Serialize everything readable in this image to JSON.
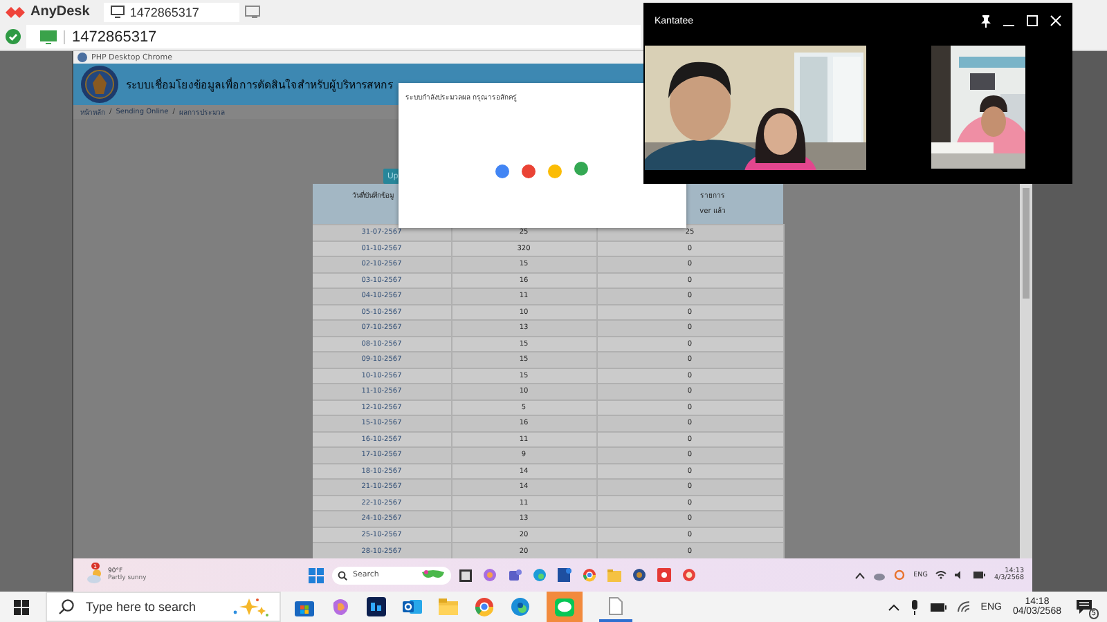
{
  "anydesk": {
    "app_name": "AnyDesk",
    "tab_label": "1472865317",
    "address": "1472865317"
  },
  "remote_window": {
    "title": "PHP Desktop Chrome",
    "site_title": "ระบบเชื่อมโยงข้อมูลเพื่อการตัดสินใจสำหรับผู้บริหารสหกร",
    "breadcrumb": [
      "หน้าหลัก",
      "Sending Online",
      "ผลการประมวล"
    ],
    "breadcrumb_separator": "/",
    "button": "Up",
    "table": {
      "column_1_header": "วันที่บันทึกข้อมู",
      "column_3_header": [
        "รายการ",
        "ver แล้ว"
      ],
      "rows": [
        [
          "31-07-2567",
          "25",
          "25"
        ],
        [
          "01-10-2567",
          "320",
          "0"
        ],
        [
          "02-10-2567",
          "15",
          "0"
        ],
        [
          "03-10-2567",
          "16",
          "0"
        ],
        [
          "04-10-2567",
          "11",
          "0"
        ],
        [
          "05-10-2567",
          "10",
          "0"
        ],
        [
          "07-10-2567",
          "13",
          "0"
        ],
        [
          "08-10-2567",
          "15",
          "0"
        ],
        [
          "09-10-2567",
          "15",
          "0"
        ],
        [
          "10-10-2567",
          "15",
          "0"
        ],
        [
          "11-10-2567",
          "10",
          "0"
        ],
        [
          "12-10-2567",
          "5",
          "0"
        ],
        [
          "15-10-2567",
          "16",
          "0"
        ],
        [
          "16-10-2567",
          "11",
          "0"
        ],
        [
          "17-10-2567",
          "9",
          "0"
        ],
        [
          "18-10-2567",
          "14",
          "0"
        ],
        [
          "21-10-2567",
          "14",
          "0"
        ],
        [
          "22-10-2567",
          "11",
          "0"
        ],
        [
          "24-10-2567",
          "13",
          "0"
        ],
        [
          "25-10-2567",
          "20",
          "0"
        ],
        [
          "28-10-2567",
          "20",
          "0"
        ]
      ]
    }
  },
  "dialog": {
    "message": "ระบบกำลังประมวลผล กรุณารอสักครู่",
    "dots": [
      {
        "color": "#4285f4"
      },
      {
        "color": "#ea4335"
      },
      {
        "color": "#fbbc05"
      },
      {
        "color": "#34a853"
      }
    ]
  },
  "remote_taskbar": {
    "weather_temp": "90°F",
    "weather_condition": "Partly sunny",
    "weather_badge": "1",
    "search_placeholder": "Search",
    "language": "ENG",
    "time": "14:13",
    "date": "4/3/2568"
  },
  "video_call": {
    "title": "Kantatee"
  },
  "taskbar": {
    "search_placeholder": "Type here to search",
    "language": "ENG",
    "time": "14:18",
    "date": "04/03/2568",
    "notification_count": "5"
  }
}
